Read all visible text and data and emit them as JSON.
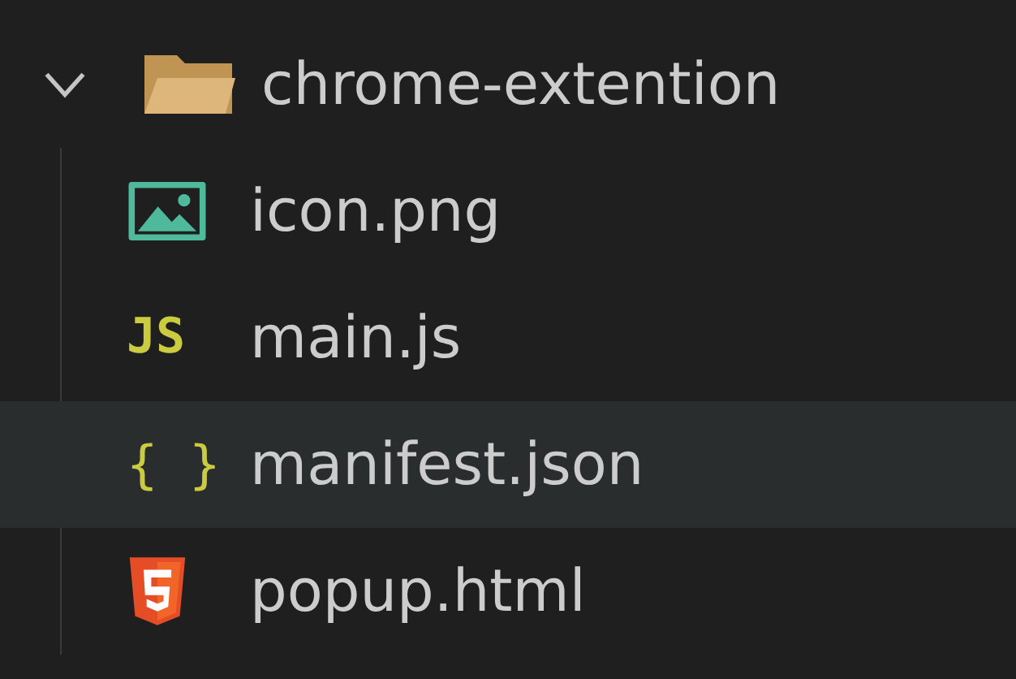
{
  "tree": [
    {
      "label": "chrome-extention",
      "kind": "folder",
      "expanded": true,
      "selected": false,
      "children": [
        {
          "label": "icon.png",
          "kind": "image",
          "selected": false
        },
        {
          "label": "main.js",
          "kind": "js",
          "icon_text": "JS",
          "selected": false
        },
        {
          "label": "manifest.json",
          "kind": "json",
          "icon_text": "{ }",
          "selected": true
        },
        {
          "label": "popup.html",
          "kind": "html",
          "selected": false
        }
      ]
    }
  ]
}
